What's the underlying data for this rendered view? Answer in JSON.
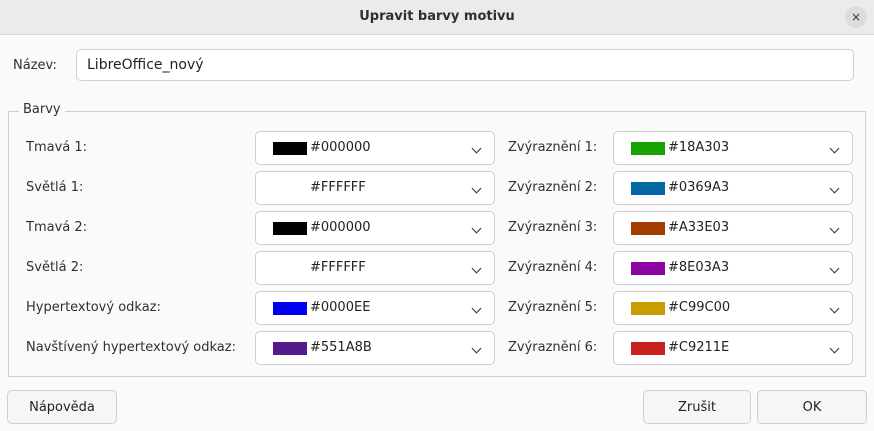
{
  "dialog": {
    "title": "Upravit barvy motivu",
    "close_icon": "×"
  },
  "name": {
    "label": "Název:",
    "value": "LibreOffice_nový"
  },
  "colors_group": {
    "title": "Barvy",
    "left": [
      {
        "label": "Tmavá 1:",
        "value": "#000000",
        "swatch": "#000000"
      },
      {
        "label": "Světlá 1:",
        "value": "#FFFFFF",
        "swatch": "#FFFFFF"
      },
      {
        "label": "Tmavá 2:",
        "value": "#000000",
        "swatch": "#000000"
      },
      {
        "label": "Světlá 2:",
        "value": "#FFFFFF",
        "swatch": "#FFFFFF"
      },
      {
        "label": "Hypertextový odkaz:",
        "value": "#0000EE",
        "swatch": "#0000EE"
      },
      {
        "label": "Navštívený hypertextový odkaz:",
        "value": "#551A8B",
        "swatch": "#551A8B"
      }
    ],
    "right": [
      {
        "label": "Zvýraznění 1:",
        "value": "#18A303",
        "swatch": "#18A303"
      },
      {
        "label": "Zvýraznění 2:",
        "value": "#0369A3",
        "swatch": "#0369A3"
      },
      {
        "label": "Zvýraznění 3:",
        "value": "#A33E03",
        "swatch": "#A33E03"
      },
      {
        "label": "Zvýraznění 4:",
        "value": "#8E03A3",
        "swatch": "#8E03A3"
      },
      {
        "label": "Zvýraznění 5:",
        "value": "#C99C00",
        "swatch": "#C99C00"
      },
      {
        "label": "Zvýraznění 6:",
        "value": "#C9211E",
        "swatch": "#C9211E"
      }
    ]
  },
  "buttons": {
    "help": "Nápověda",
    "cancel": "Zrušit",
    "ok": "OK"
  }
}
